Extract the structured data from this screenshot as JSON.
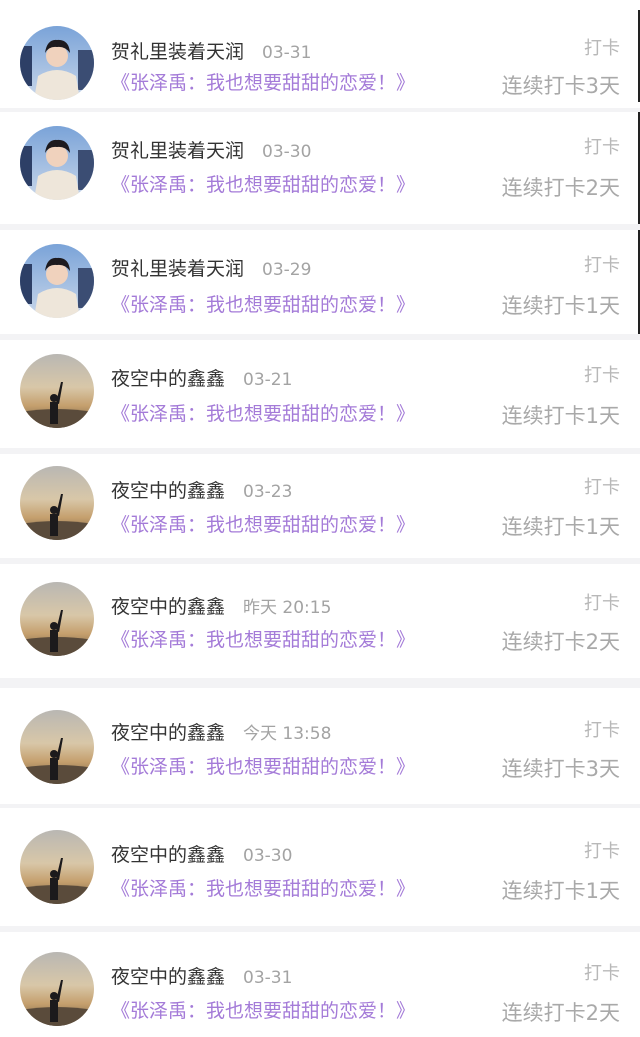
{
  "items": [
    {
      "user": "贺礼里装着天润",
      "date": "03-31",
      "tag": "打卡",
      "title": "《张泽禹：我也想要甜甜的恋爱！》",
      "streak": "连续打卡3天",
      "avatar": "avatar-person-photo"
    },
    {
      "user": "贺礼里装着天润",
      "date": "03-30",
      "tag": "打卡",
      "title": "《张泽禹：我也想要甜甜的恋爱！》",
      "streak": "连续打卡2天",
      "avatar": "avatar-person-photo"
    },
    {
      "user": "贺礼里装着天润",
      "date": "03-29",
      "tag": "打卡",
      "title": "《张泽禹：我也想要甜甜的恋爱！》",
      "streak": "连续打卡1天",
      "avatar": "avatar-person-photo"
    },
    {
      "user": "夜空中的鑫鑫",
      "date": "03-21",
      "tag": "打卡",
      "title": "《张泽禹：我也想要甜甜的恋爱！》",
      "streak": "连续打卡1天",
      "avatar": "avatar-sunset-silhouette"
    },
    {
      "user": "夜空中的鑫鑫",
      "date": "03-23",
      "tag": "打卡",
      "title": "《张泽禹：我也想要甜甜的恋爱！》",
      "streak": "连续打卡1天",
      "avatar": "avatar-sunset-silhouette"
    },
    {
      "user": "夜空中的鑫鑫",
      "date": "昨天 20:15",
      "tag": "打卡",
      "title": "《张泽禹：我也想要甜甜的恋爱！》",
      "streak": "连续打卡2天",
      "avatar": "avatar-sunset-silhouette"
    },
    {
      "user": "夜空中的鑫鑫",
      "date": "今天 13:58",
      "tag": "打卡",
      "title": "《张泽禹：我也想要甜甜的恋爱！》",
      "streak": "连续打卡3天",
      "avatar": "avatar-sunset-silhouette"
    },
    {
      "user": "夜空中的鑫鑫",
      "date": "03-30",
      "tag": "打卡",
      "title": "《张泽禹：我也想要甜甜的恋爱！》",
      "streak": "连续打卡1天",
      "avatar": "avatar-sunset-silhouette"
    },
    {
      "user": "夜空中的鑫鑫",
      "date": "03-31",
      "tag": "打卡",
      "title": "《张泽禹：我也想要甜甜的恋爱！》",
      "streak": "连续打卡2天",
      "avatar": "avatar-sunset-silhouette"
    }
  ]
}
